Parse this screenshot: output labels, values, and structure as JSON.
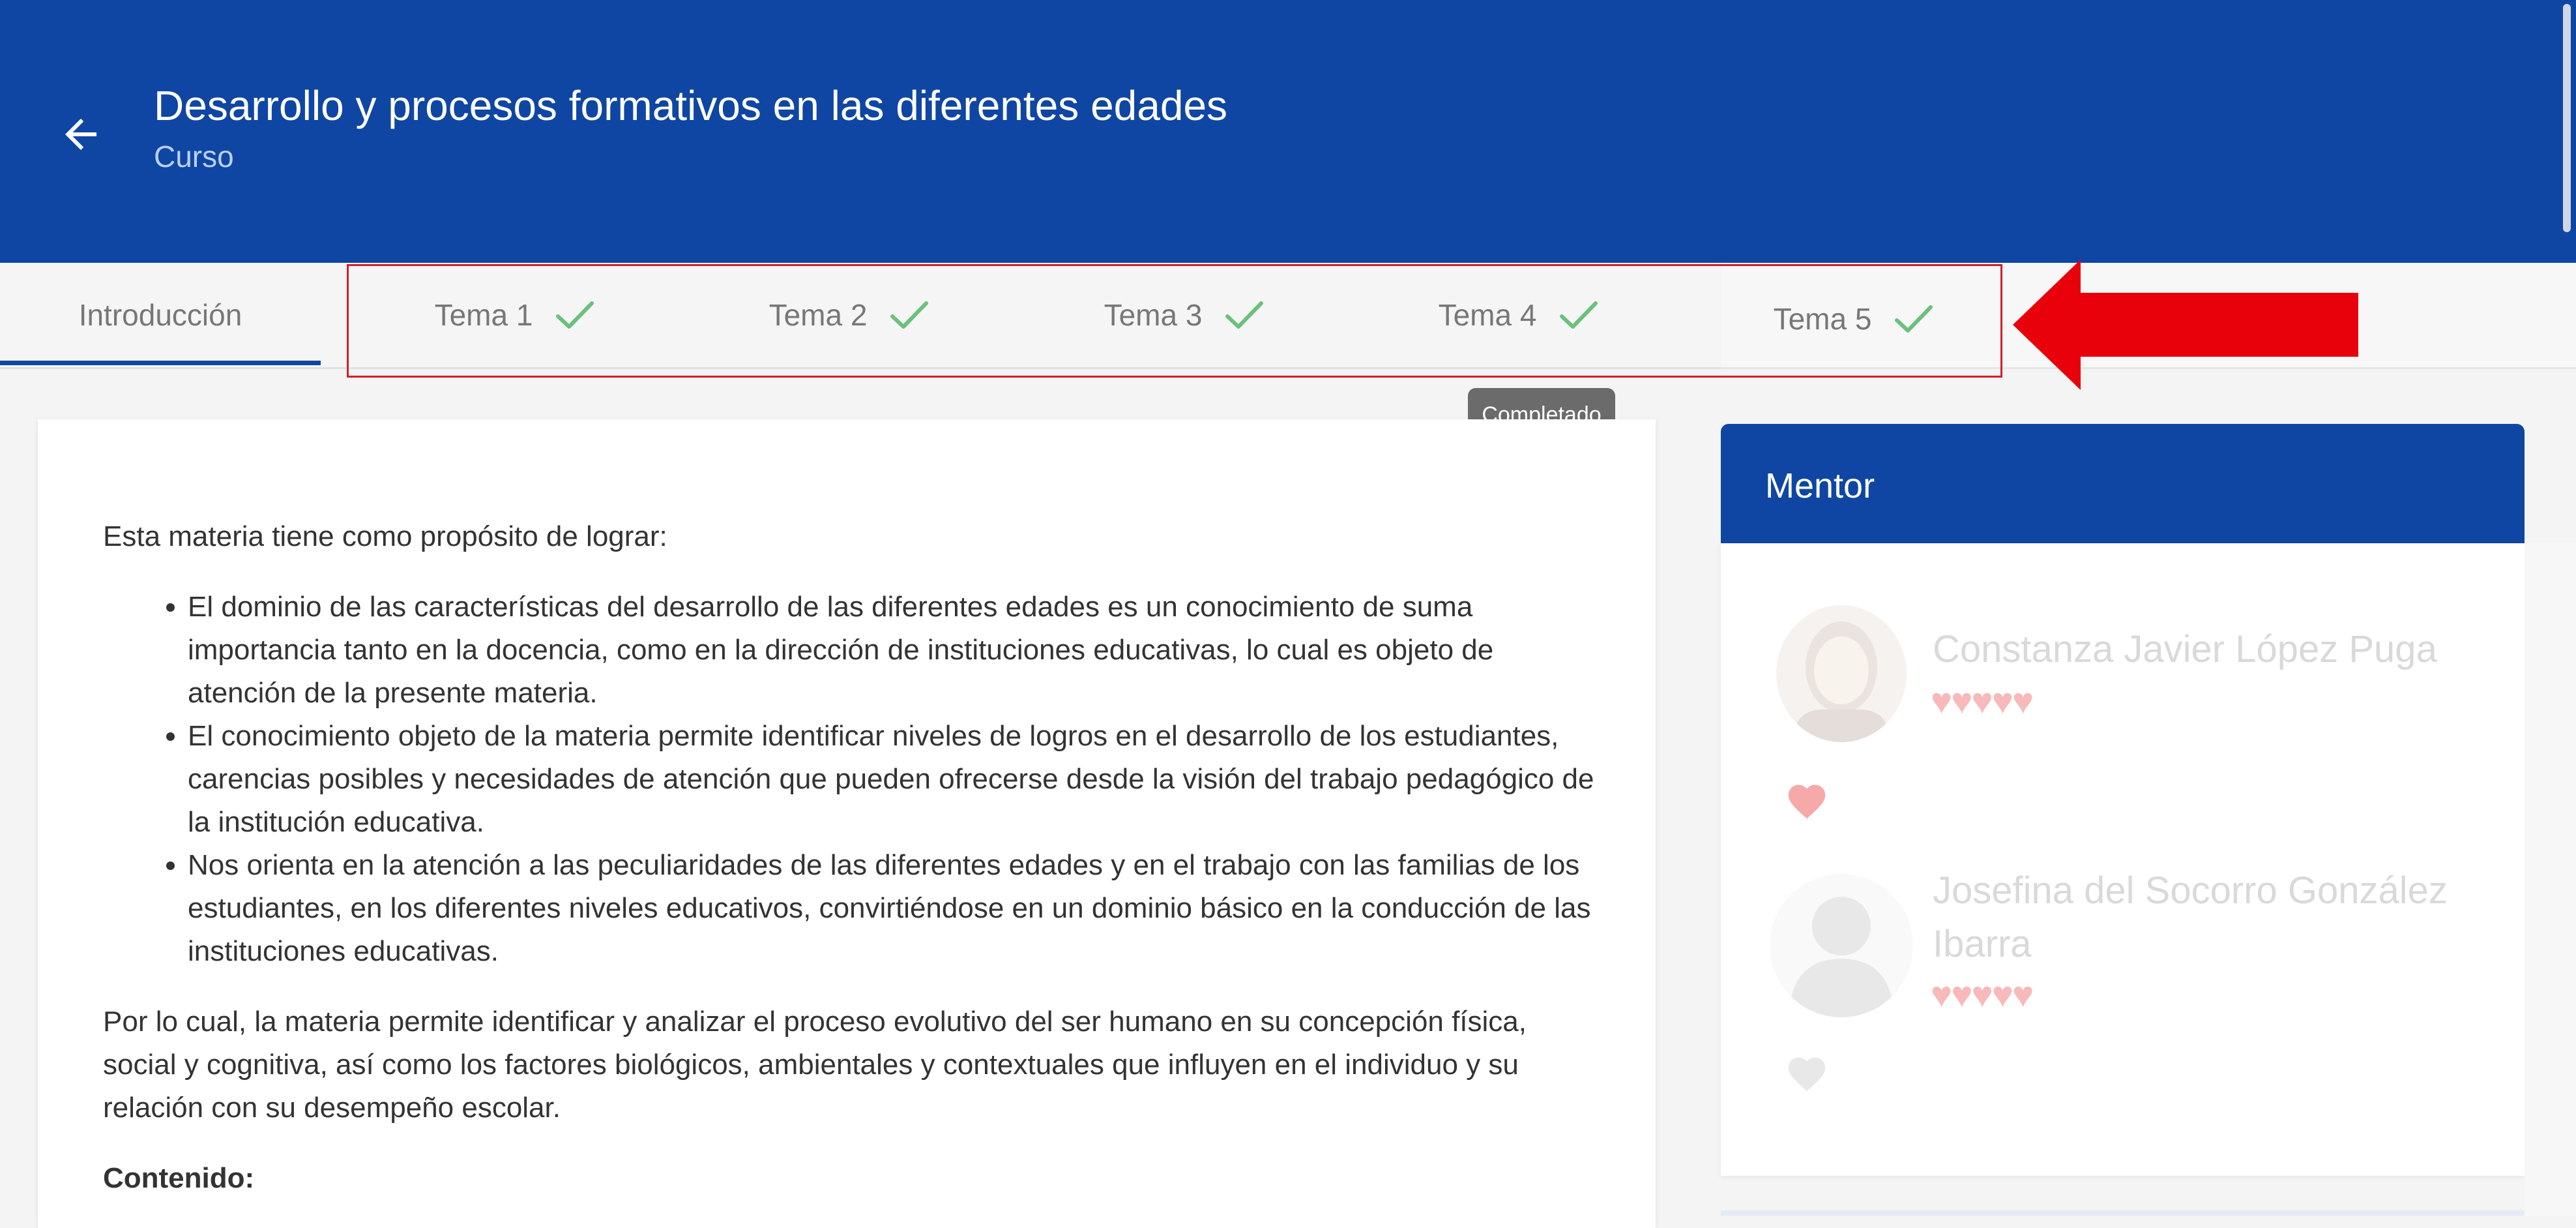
{
  "header": {
    "title": "Desarrollo y procesos formativos en las diferentes edades",
    "subtitle": "Curso"
  },
  "tabs": [
    {
      "label": "Introducción",
      "active": true,
      "completed": false
    },
    {
      "label": "Tema 1",
      "completed": true
    },
    {
      "label": "Tema 2",
      "completed": true
    },
    {
      "label": "Tema 3",
      "completed": true
    },
    {
      "label": "Tema 4",
      "completed": true
    },
    {
      "label": "Tema 5",
      "completed": true
    }
  ],
  "tooltip": "Completado",
  "content": {
    "intro": "Esta materia tiene como propósito de lograr:",
    "bullets": [
      "El dominio de las características del desarrollo de las diferentes edades es un conocimiento de suma importancia tanto en la docencia, como en la dirección de instituciones educativas, lo cual es objeto de atención de la presente materia.",
      "El conocimiento objeto de la materia permite identificar niveles de logros en el desarrollo de los estudiantes, carencias posibles y necesidades de atención que pueden ofrecerse desde la visión del trabajo pedagógico de la institución educativa.",
      "Nos orienta en la atención a las peculiaridades de las diferentes edades y en el trabajo con las familias de los estudiantes, en los diferentes niveles educativos, convirtiéndose en un dominio básico en la conducción de las instituciones educativas."
    ],
    "paragraph": "Por lo cual, la materia permite identificar y analizar el proceso evolutivo del ser humano en su concepción física, social y cognitiva, así como los factores biológicos, ambientales y contextuales que influyen en el individuo y su relación con su desempeño escolar.",
    "section_title": "Contenido:"
  },
  "mentor": {
    "title": "Mentor",
    "mentors": [
      {
        "name": "Constanza Javier López Puga",
        "rating_hearts": "♥♥♥♥♥",
        "rating": 5,
        "favorite": true
      },
      {
        "name_line1": "Josefina del Socorro González",
        "name_line2": "Ibarra",
        "rating_hearts": "♥♥♥♥♥",
        "rating": 5,
        "favorite": false
      }
    ]
  },
  "colors": {
    "primary": "#0f46a3",
    "check": "#6cc07c",
    "annotation_red": "#e8000b"
  }
}
